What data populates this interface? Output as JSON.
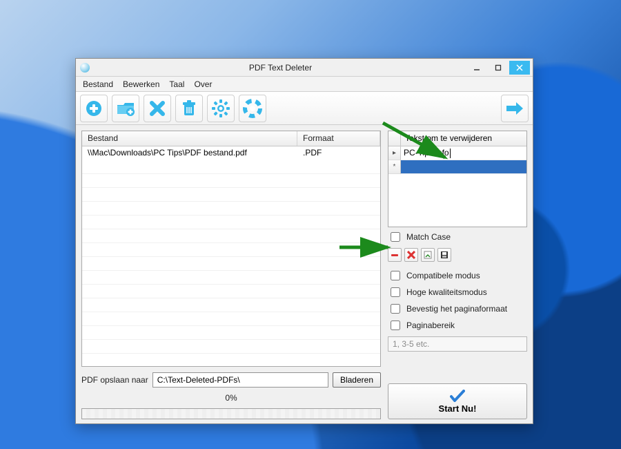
{
  "window": {
    "title": "PDF Text Deleter"
  },
  "menu": {
    "file": "Bestand",
    "edit": "Bewerken",
    "lang": "Taal",
    "about": "Over"
  },
  "toolbar_icons": {
    "add": "add-file",
    "addfolder": "add-folder",
    "remove": "remove",
    "trash": "trash",
    "settings": "settings",
    "help": "help",
    "next": "next"
  },
  "grid": {
    "col_file": "Bestand",
    "col_format": "Formaat",
    "rows": [
      {
        "file": "\\\\Mac\\Downloads\\PC Tips\\PDF bestand.pdf",
        "format": ".PDF"
      }
    ]
  },
  "save": {
    "label": "PDF opslaan naar",
    "path": "C:\\Text-Deleted-PDFs\\",
    "browse": "Bladeren"
  },
  "progress": {
    "text": "0%"
  },
  "remove": {
    "header": "Tekst om te verwijderen",
    "rows": [
      {
        "text": "PC-Tips.info",
        "active": true
      },
      {
        "text": "",
        "selected": true
      }
    ]
  },
  "options": {
    "match_case": "Match Case",
    "compatible": "Compatibele modus",
    "highq": "Hoge kwaliteitsmodus",
    "confirm": "Bevestig het paginaformaat",
    "range": "Paginabereik",
    "range_hint": "1, 3-5 etc."
  },
  "start": {
    "label": "Start Nu!"
  }
}
